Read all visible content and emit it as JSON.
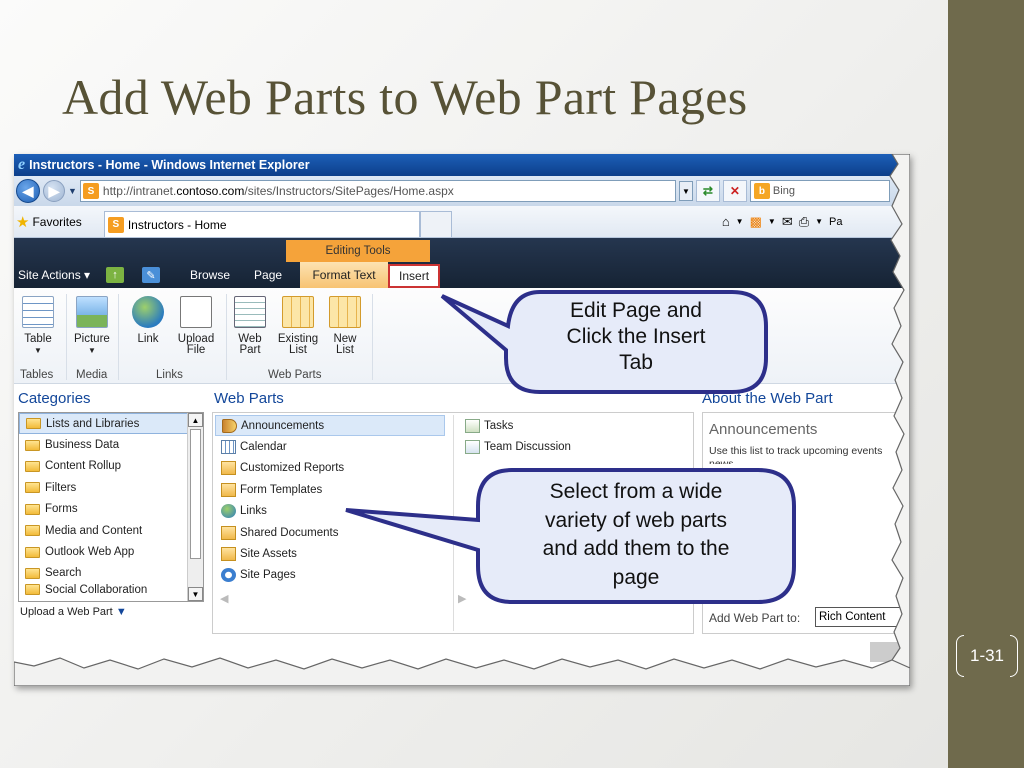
{
  "slide": {
    "title": "Add Web Parts to Web Part Pages",
    "page_number": "1-31"
  },
  "browser": {
    "window_title": "Instructors - Home - Windows Internet Explorer",
    "url_prefix": "http://intranet.",
    "url_domain": "contoso.com",
    "url_path": "/sites/Instructors/SitePages/Home.aspx",
    "search_placeholder": "Bing",
    "favorites_label": "Favorites",
    "tab_title": "Instructors - Home",
    "page_menu_partial": "Pa"
  },
  "ribbon": {
    "contextual_group": "Editing Tools",
    "site_actions": "Site Actions",
    "tabs": [
      {
        "label": "Browse"
      },
      {
        "label": "Page"
      },
      {
        "label": "Format Text"
      },
      {
        "label": "Insert"
      }
    ],
    "buttons": [
      {
        "label": "Table",
        "icon": "table-icon"
      },
      {
        "label": "Picture",
        "icon": "picture-icon"
      },
      {
        "label": "Link",
        "icon": "link-icon"
      },
      {
        "label": "Upload File",
        "icon": "upload-icon"
      },
      {
        "label": "Web Part",
        "icon": "web-part-icon"
      },
      {
        "label": "Existing List",
        "icon": "existing-list-icon"
      },
      {
        "label": "New List",
        "icon": "new-list-icon"
      }
    ],
    "groups": [
      "Tables",
      "Media",
      "Links",
      "Web Parts"
    ]
  },
  "categories": {
    "title": "Categories",
    "items": [
      "Lists and Libraries",
      "Business Data",
      "Content Rollup",
      "Filters",
      "Forms",
      "Media and Content",
      "Outlook Web App",
      "Search",
      "Social Collaboration"
    ],
    "selected": "Lists and Libraries",
    "upload_link": "Upload a Web Part"
  },
  "web_parts": {
    "title": "Web Parts",
    "column1": [
      "Announcements",
      "Calendar",
      "Customized Reports",
      "Form Templates",
      "Links",
      "Shared Documents",
      "Site Assets",
      "Site Pages"
    ],
    "column2": [
      "Tasks",
      "Team Discussion"
    ],
    "selected": "Announcements"
  },
  "about": {
    "title": "About the Web Part",
    "name": "Announcements",
    "description": "Use this list to track upcoming events",
    "description_cont": "news",
    "add_label": "Add Web Part to:",
    "zone_value": "Rich Content"
  },
  "callouts": {
    "top": {
      "line1": "Edit Page and",
      "line2": "Click the Insert",
      "line3": "Tab"
    },
    "bottom": {
      "line1": "Select from a wide",
      "line2": "variety of web parts",
      "line3": "and add them to the",
      "line4": "page"
    }
  }
}
